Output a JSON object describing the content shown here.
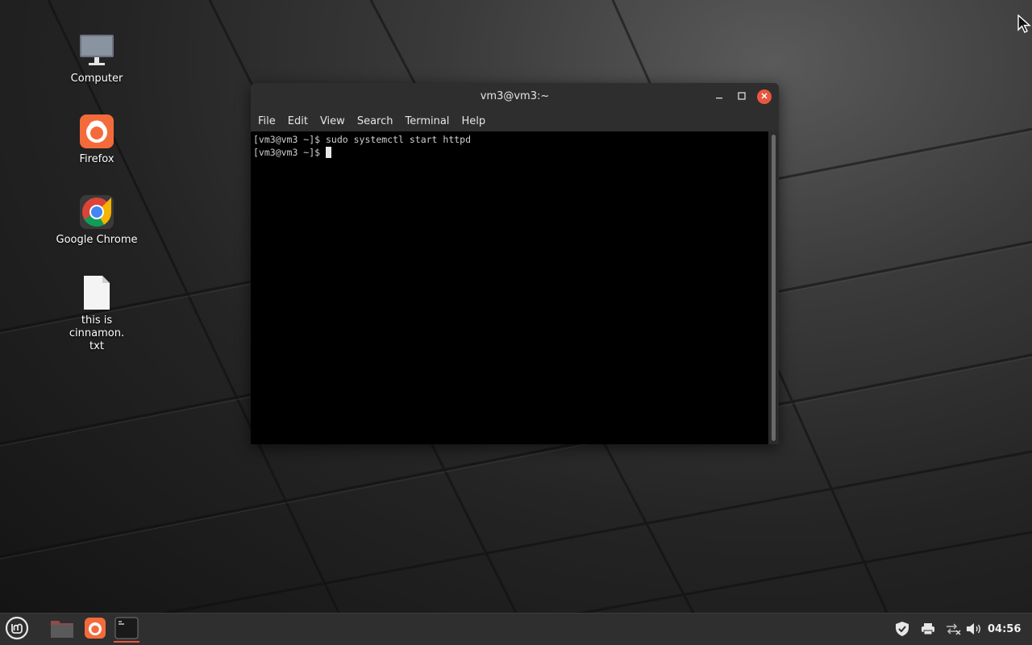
{
  "desktop": {
    "icons": [
      {
        "label": "Computer",
        "icon": "computer-icon"
      },
      {
        "label": "Firefox",
        "icon": "firefox-icon"
      },
      {
        "label": "Google Chrome",
        "icon": "chrome-icon"
      },
      {
        "label": "this is cinnamon.",
        "label2": "txt",
        "icon": "text-file-icon"
      }
    ]
  },
  "terminal": {
    "title": "vm3@vm3:~",
    "menu": [
      "File",
      "Edit",
      "View",
      "Search",
      "Terminal",
      "Help"
    ],
    "lines": [
      "[vm3@vm3 ~]$ sudo systemctl start httpd",
      "[vm3@vm3 ~]$ "
    ],
    "controls": {
      "minimize": "minimize-icon",
      "maximize": "maximize-icon",
      "close": "close-icon"
    }
  },
  "taskbar": {
    "menu_icon": "mint-menu-icon",
    "launchers": [
      "files-icon",
      "firefox-icon",
      "terminal-icon"
    ],
    "tray": [
      "shield-icon",
      "printer-icon",
      "network-icon",
      "volume-icon"
    ],
    "clock": "04:56"
  },
  "colors": {
    "accent": "#e9573f",
    "terminal_bg": "#000000",
    "panel_bg": "#2f2f2f"
  }
}
